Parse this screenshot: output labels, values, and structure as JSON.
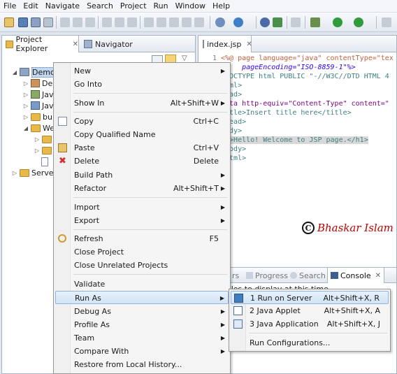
{
  "menubar": [
    "File",
    "Edit",
    "Navigate",
    "Search",
    "Project",
    "Run",
    "Window",
    "Help"
  ],
  "project_explorer": {
    "tab_active": "Project Explorer",
    "tab_inactive": "Navigator",
    "tree": [
      {
        "label": "Demo_"
      },
      {
        "label": "Dep"
      },
      {
        "label": "Jav"
      },
      {
        "label": "Jav"
      },
      {
        "label": "buil"
      },
      {
        "label": "We"
      },
      {
        "label": ""
      },
      {
        "label": ""
      },
      {
        "label": ""
      },
      {
        "label": "Servers"
      }
    ]
  },
  "editor": {
    "tab": "index.jsp",
    "lines": [
      {
        "num": "1",
        "text": "<%@ page language=\"java\" contentType=\"tex"
      },
      {
        "num": "",
        "text": "     pageEncoding=\"ISO-8859-1\"%>"
      },
      {
        "num": "",
        "text": "!DOCTYPE html PUBLIC \"-//W3C//DTD HTML 4"
      },
      {
        "num": "",
        "text": "html>"
      },
      {
        "num": "",
        "text": "head>"
      },
      {
        "num": "",
        "text": "meta http-equiv=\"Content-Type\" content=\""
      },
      {
        "num": "",
        "text": "title>Insert title here</title>"
      },
      {
        "num": "",
        "text": "/head>"
      },
      {
        "num": "",
        "text": "body>"
      },
      {
        "num": "",
        "text": "h1>Hello! Welcome to JSP page.</h1>"
      },
      {
        "num": "",
        "text": "/body>"
      },
      {
        "num": "",
        "text": "/html>"
      }
    ],
    "watermark": "Bhaskar Islam",
    "watermark_symbol": "C"
  },
  "bottom_panel": {
    "tabs": [
      "rs",
      "Progress",
      "Search",
      "Console"
    ],
    "content": "oles to display at this time."
  },
  "context_menu": {
    "items": [
      {
        "label": "New",
        "accel": "",
        "submenu": true
      },
      {
        "label": "Go Into",
        "accel": "",
        "submenu": false
      },
      {
        "label": "Show In",
        "accel": "Alt+Shift+W",
        "submenu": true
      },
      {
        "label": "Copy",
        "accel": "Ctrl+C",
        "submenu": false
      },
      {
        "label": "Copy Qualified Name",
        "accel": "",
        "submenu": false
      },
      {
        "label": "Paste",
        "accel": "Ctrl+V",
        "submenu": false
      },
      {
        "label": "Delete",
        "accel": "Delete",
        "submenu": false
      },
      {
        "label": "Build Path",
        "accel": "",
        "submenu": true
      },
      {
        "label": "Refactor",
        "accel": "Alt+Shift+T",
        "submenu": true
      },
      {
        "label": "Import",
        "accel": "",
        "submenu": true
      },
      {
        "label": "Export",
        "accel": "",
        "submenu": true
      },
      {
        "label": "Refresh",
        "accel": "F5",
        "submenu": false
      },
      {
        "label": "Close Project",
        "accel": "",
        "submenu": false
      },
      {
        "label": "Close Unrelated Projects",
        "accel": "",
        "submenu": false
      },
      {
        "label": "Validate",
        "accel": "",
        "submenu": false
      },
      {
        "label": "Run As",
        "accel": "",
        "submenu": true
      },
      {
        "label": "Debug As",
        "accel": "",
        "submenu": true
      },
      {
        "label": "Profile As",
        "accel": "",
        "submenu": true
      },
      {
        "label": "Team",
        "accel": "",
        "submenu": true
      },
      {
        "label": "Compare With",
        "accel": "",
        "submenu": true
      },
      {
        "label": "Restore from Local History...",
        "accel": "",
        "submenu": false
      }
    ]
  },
  "run_as_submenu": {
    "items": [
      {
        "label": "1 Run on Server",
        "accel": "Alt+Shift+X, R"
      },
      {
        "label": "2 Java Applet",
        "accel": "Alt+Shift+X, A"
      },
      {
        "label": "3 Java Application",
        "accel": "Alt+Shift+X, J"
      },
      {
        "label": "Run Configurations...",
        "accel": ""
      }
    ]
  },
  "colors": {
    "accent": "#c3d7ef",
    "hover_border": "#8db2e3",
    "delete_icon": "#d22f2f",
    "watermark": "#c00000"
  }
}
